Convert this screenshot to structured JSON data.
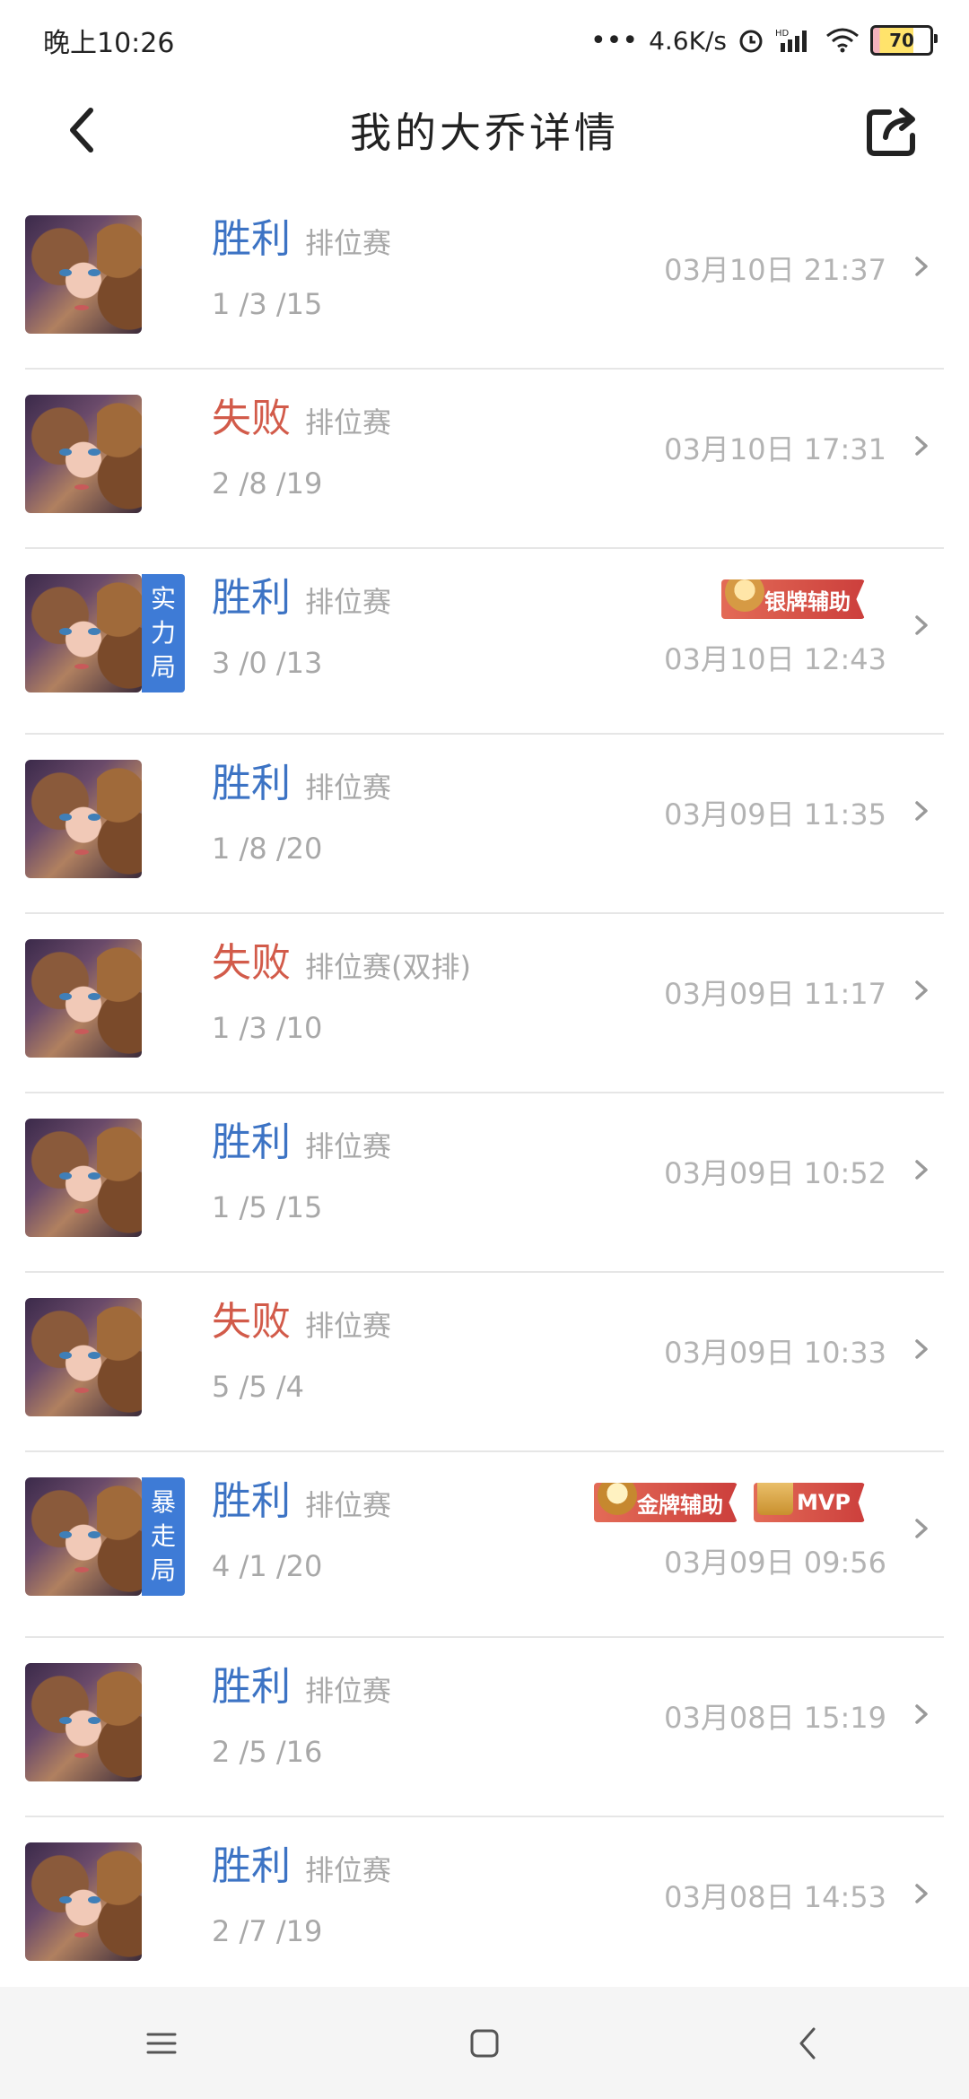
{
  "status_bar": {
    "time": "晚上10:26",
    "net_speed": "4.6K/s",
    "battery": "70",
    "icons": [
      "dots-icon",
      "alarm-icon",
      "hd-signal-icon",
      "wifi-icon",
      "battery-icon"
    ]
  },
  "header": {
    "title": "我的大乔详情",
    "back_icon": "chevron-left-icon",
    "share_icon": "share-icon"
  },
  "matches": [
    {
      "result": "胜利",
      "outcome": "win",
      "mode": "排位赛",
      "kda": "1 /3 /15",
      "time": "03月10日 21:37",
      "tag": "",
      "badges": []
    },
    {
      "result": "失败",
      "outcome": "lose",
      "mode": "排位赛",
      "kda": "2 /8 /19",
      "time": "03月10日 17:31",
      "tag": "",
      "badges": []
    },
    {
      "result": "胜利",
      "outcome": "win",
      "mode": "排位赛",
      "kda": "3 /0 /13",
      "time": "03月10日 12:43",
      "tag": "实力局",
      "badges": [
        {
          "type": "silver",
          "label": "银牌辅助"
        }
      ]
    },
    {
      "result": "胜利",
      "outcome": "win",
      "mode": "排位赛",
      "kda": "1 /8 /20",
      "time": "03月09日 11:35",
      "tag": "",
      "badges": []
    },
    {
      "result": "失败",
      "outcome": "lose",
      "mode": "排位赛(双排)",
      "kda": "1 /3 /10",
      "time": "03月09日 11:17",
      "tag": "",
      "badges": []
    },
    {
      "result": "胜利",
      "outcome": "win",
      "mode": "排位赛",
      "kda": "1 /5 /15",
      "time": "03月09日 10:52",
      "tag": "",
      "badges": []
    },
    {
      "result": "失败",
      "outcome": "lose",
      "mode": "排位赛",
      "kda": "5 /5 /4",
      "time": "03月09日 10:33",
      "tag": "",
      "badges": []
    },
    {
      "result": "胜利",
      "outcome": "win",
      "mode": "排位赛",
      "kda": "4 /1 /20",
      "time": "03月09日 09:56",
      "tag": "暴走局",
      "badges": [
        {
          "type": "gold",
          "label": "金牌辅助"
        },
        {
          "type": "mvp",
          "label": "MVP"
        }
      ]
    },
    {
      "result": "胜利",
      "outcome": "win",
      "mode": "排位赛",
      "kda": "2 /5 /16",
      "time": "03月08日 15:19",
      "tag": "",
      "badges": []
    },
    {
      "result": "胜利",
      "outcome": "win",
      "mode": "排位赛",
      "kda": "2 /7 /19",
      "time": "03月08日 14:53",
      "tag": "",
      "badges": []
    }
  ],
  "nav_bar": {
    "icons": [
      "menu-icon",
      "home-square-icon",
      "back-triangle-icon"
    ]
  },
  "colors": {
    "win": "#3c73c4",
    "lose": "#d25b4a",
    "tag_bg": "#3e7bd6",
    "muted": "#a8a8a8"
  }
}
